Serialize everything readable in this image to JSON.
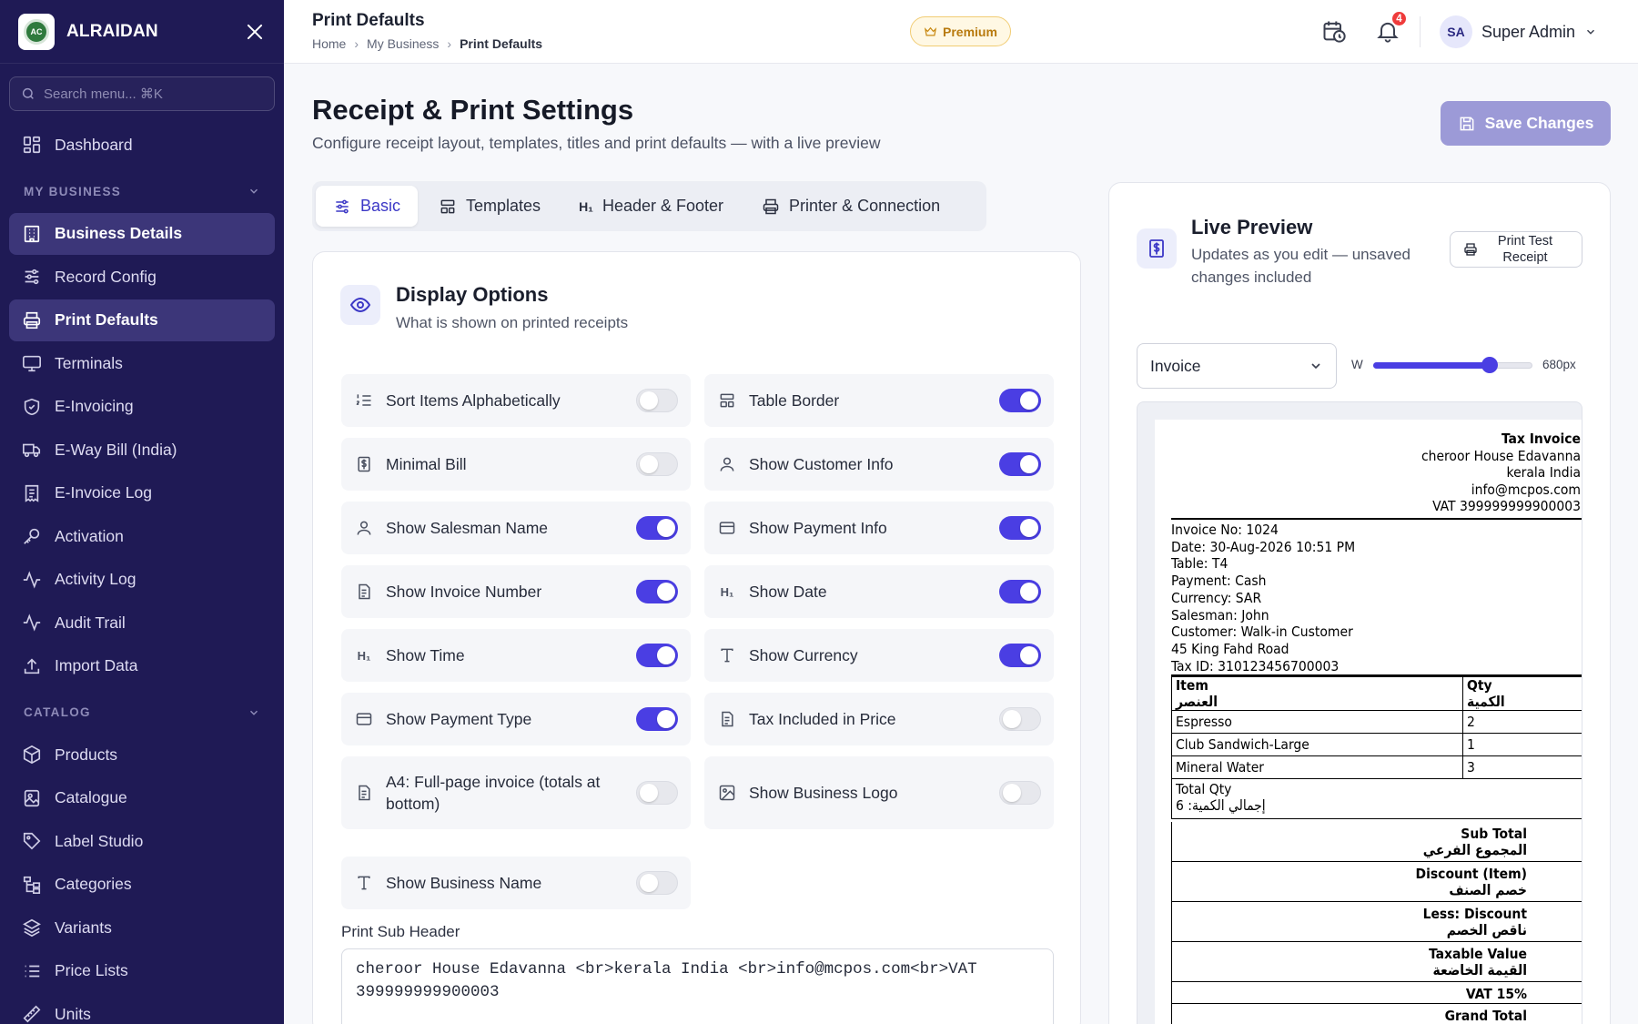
{
  "brand": {
    "name": "ALRAIDAN",
    "logo_text": "AC"
  },
  "search": {
    "placeholder": "Search menu... ⌘K"
  },
  "nav": {
    "top": [
      {
        "label": "Dashboard",
        "icon": "dashboard-icon"
      }
    ],
    "sections": [
      {
        "title": "MY BUSINESS",
        "items": [
          {
            "label": "Business Details",
            "icon": "building-icon",
            "active": true
          },
          {
            "label": "Record Config",
            "icon": "sliders-icon"
          },
          {
            "label": "Print Defaults",
            "icon": "printer-icon",
            "active": true
          },
          {
            "label": "Terminals",
            "icon": "monitor-icon"
          },
          {
            "label": "E-Invoicing",
            "icon": "shield-icon"
          },
          {
            "label": "E-Way Bill (India)",
            "icon": "truck-icon"
          },
          {
            "label": "E-Invoice Log",
            "icon": "receipt-icon"
          },
          {
            "label": "Activation",
            "icon": "key-icon"
          },
          {
            "label": "Activity Log",
            "icon": "activity-icon"
          },
          {
            "label": "Audit Trail",
            "icon": "pulse-icon"
          },
          {
            "label": "Import Data",
            "icon": "upload-icon"
          }
        ]
      },
      {
        "title": "CATALOG",
        "items": [
          {
            "label": "Products",
            "icon": "box-icon"
          },
          {
            "label": "Catalogue",
            "icon": "image-book-icon"
          },
          {
            "label": "Label Studio",
            "icon": "tag-icon"
          },
          {
            "label": "Categories",
            "icon": "tree-icon"
          },
          {
            "label": "Variants",
            "icon": "layers-icon"
          },
          {
            "label": "Price Lists",
            "icon": "list-icon"
          },
          {
            "label": "Units",
            "icon": "ruler-icon"
          }
        ]
      }
    ]
  },
  "topbar": {
    "title": "Print Defaults",
    "breadcrumb": [
      "Home",
      "My Business",
      "Print Defaults"
    ],
    "premium": "Premium",
    "notifications": "4",
    "user": {
      "initials": "SA",
      "name": "Super Admin"
    }
  },
  "header": {
    "title": "Receipt & Print Settings",
    "subtitle": "Configure receipt layout, templates, titles and print defaults — with a live preview",
    "save": "Save Changes"
  },
  "tabs": [
    {
      "label": "Basic",
      "icon": "sliders-icon",
      "active": true
    },
    {
      "label": "Templates",
      "icon": "layout-icon"
    },
    {
      "label": "Header & Footer",
      "icon": "heading-icon"
    },
    {
      "label": "Printer & Connection",
      "icon": "printer-icon"
    }
  ],
  "display_options": {
    "title": "Display Options",
    "subtitle": "What is shown on printed receipts",
    "options": [
      {
        "label": "Sort Items Alphabetically",
        "icon": "sort-list-icon",
        "on": false
      },
      {
        "label": "Table Border",
        "icon": "table-icon",
        "on": true
      },
      {
        "label": "Minimal Bill",
        "icon": "receipt-icon",
        "on": false
      },
      {
        "label": "Show Customer Info",
        "icon": "user-icon",
        "on": true
      },
      {
        "label": "Show Salesman Name",
        "icon": "user-icon",
        "on": true
      },
      {
        "label": "Show Payment Info",
        "icon": "card-icon",
        "on": true
      },
      {
        "label": "Show Invoice Number",
        "icon": "file-icon",
        "on": true
      },
      {
        "label": "Show Date",
        "icon": "heading-icon",
        "on": true
      },
      {
        "label": "Show Time",
        "icon": "heading-icon",
        "on": true
      },
      {
        "label": "Show Currency",
        "icon": "type-icon",
        "on": true
      },
      {
        "label": "Show Payment Type",
        "icon": "card-icon",
        "on": true
      },
      {
        "label": "Tax Included in Price",
        "icon": "file-icon",
        "on": false
      },
      {
        "label": "A4: Full-page invoice (totals at bottom)",
        "icon": "file-icon",
        "on": false
      },
      {
        "label": "Show Business Logo",
        "icon": "image-icon",
        "on": false
      },
      {
        "label": "Show Business Name",
        "icon": "type-icon",
        "on": false
      }
    ],
    "sub_header_label": "Print Sub Header",
    "sub_header_value": "cheroor House Edavanna <br>kerala India <br>info@mcpos.com<br>VAT 399999999900003"
  },
  "preview": {
    "title": "Live Preview",
    "subtitle": "Updates as you edit — unsaved changes included",
    "print_test": "Print Test Receipt",
    "template": "Invoice",
    "width_label": "W",
    "width_value": "680px",
    "width_fraction": 0.73,
    "receipt": {
      "header_lines": [
        "Tax Invoice",
        "cheroor House Edavanna",
        "kerala India",
        "info@mcpos.com",
        "VAT 399999999900003"
      ],
      "info_lines": [
        "Invoice No: 1024",
        "Date: 30-Aug-2026 10:51 PM",
        "Table: T4",
        "Payment: Cash",
        "Currency: SAR",
        "Salesman: John",
        "Customer: Walk-in Customer",
        "45 King Fahd Road",
        "Tax ID: 310123456700003"
      ],
      "columns": {
        "item": "Item",
        "item_ar": "العنصر",
        "qty": "Qty",
        "qty_ar": "الكمية"
      },
      "rows": [
        {
          "name": "Espresso",
          "qty": "2"
        },
        {
          "name": "Club Sandwich-Large",
          "qty": "1"
        },
        {
          "name": "Mineral Water",
          "qty": "3"
        }
      ],
      "total_qty_label": "Total Qty",
      "total_qty_ar": "6 :إجمالي الكمية",
      "totals": [
        {
          "en": "Sub Total",
          "ar": "المجموع الفرعي"
        },
        {
          "en": "Discount (Item)",
          "ar": "خصم الصنف"
        },
        {
          "en": "Less: Discount",
          "ar": "ناقص الخصم"
        },
        {
          "en": "Taxable Value",
          "ar": "القيمة الخاضعة"
        },
        {
          "en": "VAT 15%",
          "ar": ""
        },
        {
          "en": "Grand Total",
          "ar": ""
        }
      ]
    }
  }
}
